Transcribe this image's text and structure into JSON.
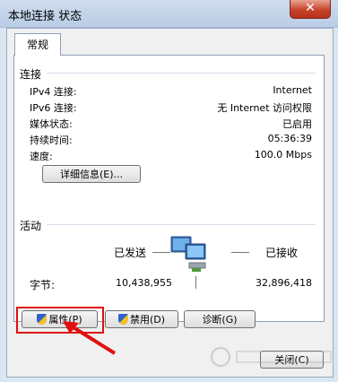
{
  "window": {
    "title": "本地连接 状态",
    "close_label": "✕"
  },
  "tabs": [
    {
      "label": "常规"
    }
  ],
  "connection": {
    "section_label": "连接",
    "rows": [
      {
        "label": "IPv4 连接:",
        "value": "Internet"
      },
      {
        "label": "IPv6 连接:",
        "value": "无 Internet 访问权限"
      },
      {
        "label": "媒体状态:",
        "value": "已启用"
      },
      {
        "label": "持续时间:",
        "value": "05:36:39"
      },
      {
        "label": "速度:",
        "value": "100.0 Mbps"
      }
    ],
    "details_button": "详细信息(E)..."
  },
  "activity": {
    "section_label": "活动",
    "sent_label": "已发送",
    "received_label": "已接收",
    "bytes_label": "字节:",
    "bytes_sent": "10,438,955",
    "bytes_received": "32,896,418"
  },
  "buttons": {
    "properties": "属性(P)",
    "disable": "禁用(D)",
    "diagnose": "诊断(G)",
    "close": "关闭(C)"
  },
  "icons": {
    "network": "network-computers-icon",
    "shield": "uac-shield-icon",
    "annotation_arrow": "red-arrow-icon",
    "watermark": "baidu-jingyan-watermark-icon"
  }
}
